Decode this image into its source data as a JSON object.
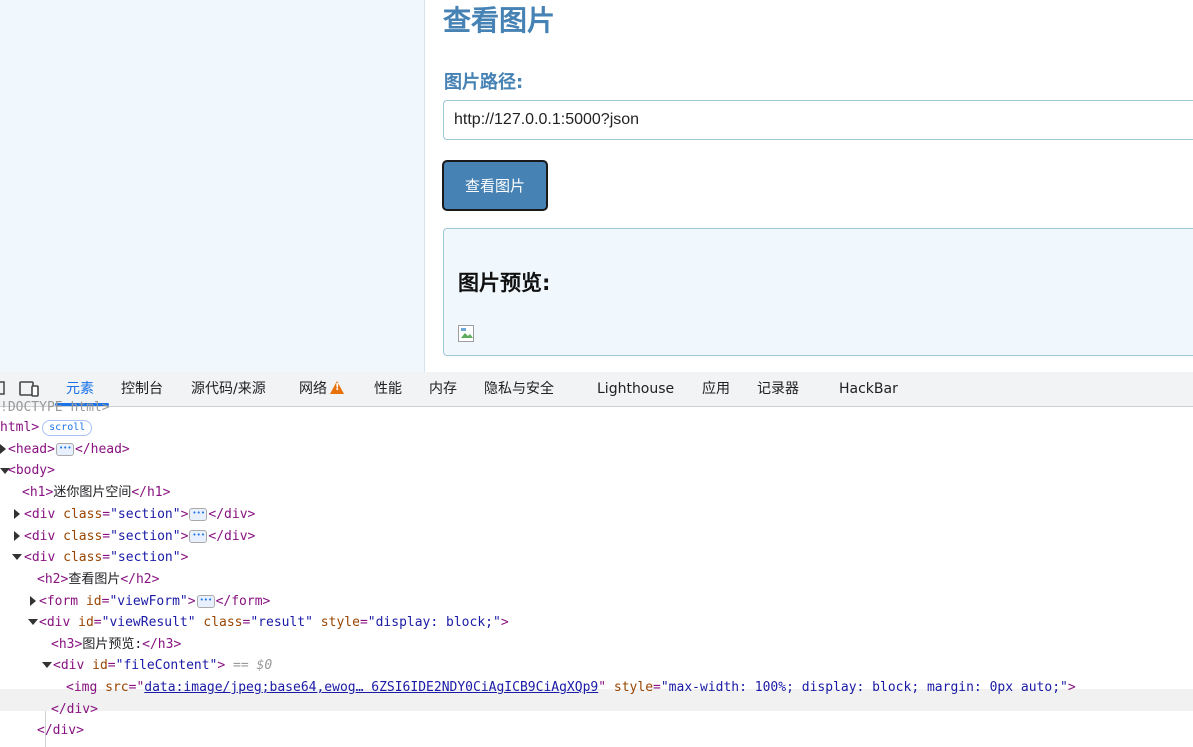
{
  "page": {
    "view_section_title": "查看图片",
    "path_label": "图片路径:",
    "path_value": "http://127.0.0.1:5000?json",
    "view_button": "查看图片",
    "preview_title": "图片预览:"
  },
  "devtools": {
    "tabs": [
      "元素",
      "控制台",
      "源代码/来源",
      "网络",
      "性能",
      "内存",
      "隐私与安全",
      "Lighthouse",
      "应用",
      "记录器",
      "HackBar"
    ],
    "active_tab": "元素",
    "network_warning_icon": "warning-triangle-icon",
    "dom": {
      "doctype": "!DOCTYPE html>",
      "html_open": "html>",
      "scroll_badge": "scroll",
      "head_open": "<head>",
      "head_close": "</head>",
      "body_open": "<body>",
      "h1_open": "<h1>",
      "h1_text": "迷你图片空间",
      "h1_close": "</h1>",
      "div_tag": "<div",
      "div_close": "</div>",
      "class_attr": "class",
      "section_val": "\"section\"",
      "gt": ">",
      "h2_open": "<h2>",
      "h2_text": "查看图片",
      "h2_close": "</h2>",
      "form_tag": "<form",
      "form_close": "</form>",
      "id_attr": "id",
      "viewform_val": "\"viewForm\"",
      "viewresult_val": "\"viewResult\"",
      "result_val": "\"result\"",
      "style_attr": "style",
      "block_val": "\"display: block;\"",
      "h3_open": "<h3>",
      "h3_text": "图片预览:",
      "h3_close": "</h3>",
      "filecontent_val": "\"fileContent\"",
      "selected_marker": "== $0",
      "img_tag": "<img",
      "src_attr": "src",
      "img_src": "data:image/jpeg;base64,ewog… 6ZSI6IDE2NDY0CiAgICB9CiAgXQp9",
      "img_style_val": "\"max-width: 100%; display: block; margin: 0px auto;\""
    }
  }
}
